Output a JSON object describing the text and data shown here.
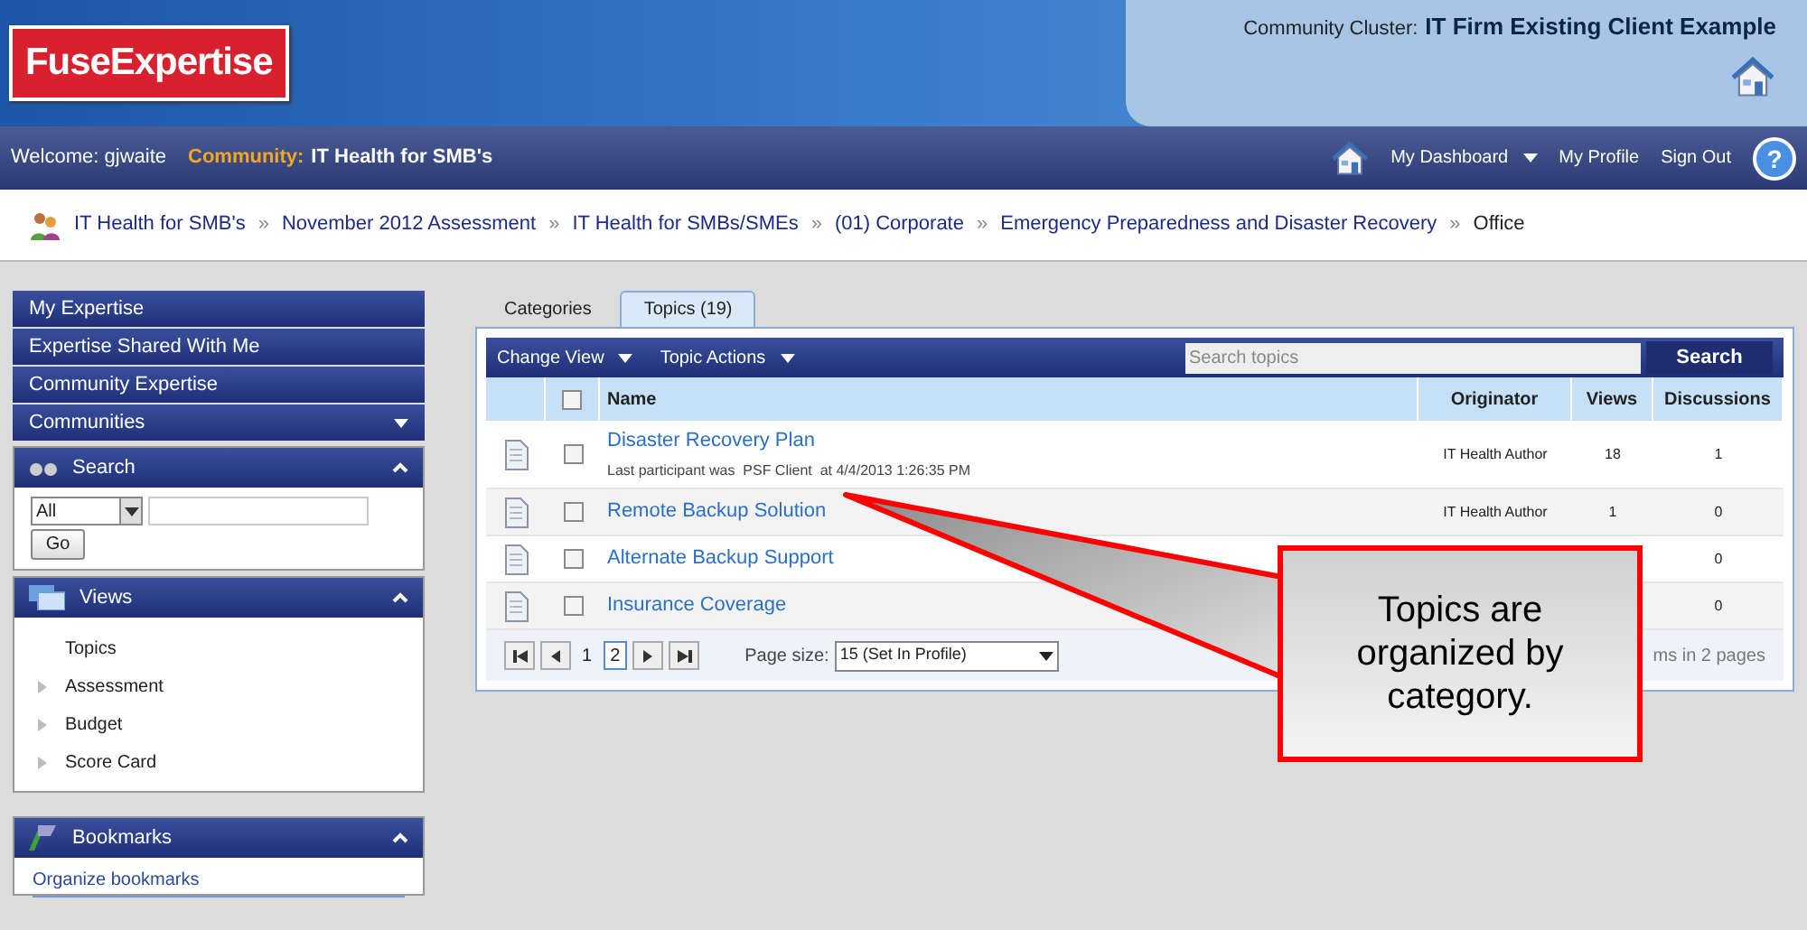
{
  "logo": "FuseExpertise",
  "cluster": {
    "label": "Community Cluster:",
    "name": "IT Firm Existing Client Example"
  },
  "navbar": {
    "welcome": "Welcome: gjwaite",
    "community_label": "Community:",
    "community": "IT Health for SMB's",
    "links": [
      "My Dashboard",
      "My Profile",
      "Sign Out"
    ],
    "help": "?"
  },
  "breadcrumb": {
    "items": [
      "IT Health for SMB's",
      "November 2012 Assessment",
      "IT Health for SMBs/SMEs",
      "(01) Corporate",
      "Emergency Preparedness and Disaster Recovery"
    ],
    "separator": "»",
    "current": "Office"
  },
  "sidebar": {
    "menu": [
      {
        "label": "My Expertise",
        "dropdown": false
      },
      {
        "label": "Expertise Shared With Me",
        "dropdown": false
      },
      {
        "label": "Community Expertise",
        "dropdown": false
      },
      {
        "label": "Communities",
        "dropdown": true
      }
    ],
    "search": {
      "title": "Search",
      "scope": "All",
      "button": "Go"
    },
    "views": {
      "title": "Views",
      "items": [
        {
          "label": "Topics",
          "expandable": false
        },
        {
          "label": "Assessment",
          "expandable": true
        },
        {
          "label": "Budget",
          "expandable": true
        },
        {
          "label": "Score Card",
          "expandable": true
        }
      ]
    },
    "bookmarks": {
      "title": "Bookmarks",
      "link": "Organize bookmarks"
    }
  },
  "tabs": [
    {
      "label": "Categories",
      "selected": false
    },
    {
      "label": "Topics (19)",
      "selected": true
    }
  ],
  "toolbar": {
    "menus": [
      "Change View",
      "Topic Actions"
    ],
    "search_placeholder": "Search topics",
    "search_button": "Search"
  },
  "table": {
    "select_all_checked": false,
    "columns": [
      "Name",
      "Originator",
      "Views",
      "Discussions"
    ],
    "rows": [
      {
        "name": "Disaster Recovery Plan",
        "note": "Last participant was  PSF Client  at 4/4/2013 1:26:35 PM",
        "originator": "IT Health Author",
        "views": "18",
        "discussions": "1",
        "checked": false
      },
      {
        "name": "Remote Backup Solution",
        "originator": "IT Health Author",
        "views": "1",
        "discussions": "0",
        "checked": false
      },
      {
        "name": "Alternate Backup Support",
        "discussions": "0",
        "checked": false
      },
      {
        "name": "Insurance Coverage",
        "discussions": "0",
        "checked": false
      }
    ]
  },
  "pager": {
    "pages": [
      {
        "label": "1",
        "selected": false
      },
      {
        "label": "2",
        "selected": true
      }
    ],
    "page_size_label": "Page size:",
    "page_size": "15 (Set In Profile)",
    "summary": "ms in 2 pages"
  },
  "callout": "Topics are organized by category."
}
